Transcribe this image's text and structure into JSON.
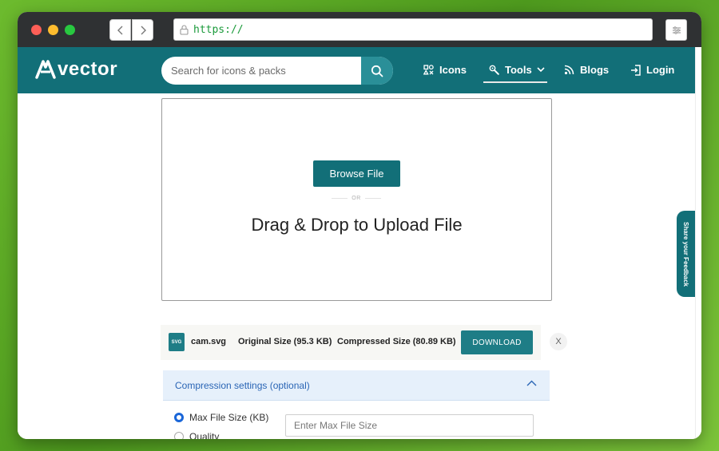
{
  "browser": {
    "url": "https://"
  },
  "site": {
    "logo_text": "vector",
    "search_placeholder": "Search for icons & packs",
    "nav": {
      "icons": "Icons",
      "tools": "Tools",
      "blogs": "Blogs",
      "login": "Login"
    },
    "brand_color": "#126f78"
  },
  "upload": {
    "browse_label": "Browse File",
    "or_text": "OR",
    "drag_text": "Drag & Drop to Upload File"
  },
  "file": {
    "badge": "SVG",
    "name": "cam.svg",
    "original_size": "Original Size (95.3 KB)",
    "compressed_size": "Compressed Size (80.89 KB)",
    "download_label": "DOWNLOAD",
    "remove_label": "X"
  },
  "settings": {
    "title": "Compression settings (optional)",
    "options": [
      {
        "label": "Max File Size (KB)",
        "selected": true
      },
      {
        "label": "Quality",
        "selected": false
      }
    ],
    "max_size_placeholder": "Enter Max File Size"
  },
  "feedback": {
    "label": "Share your Feedback"
  }
}
